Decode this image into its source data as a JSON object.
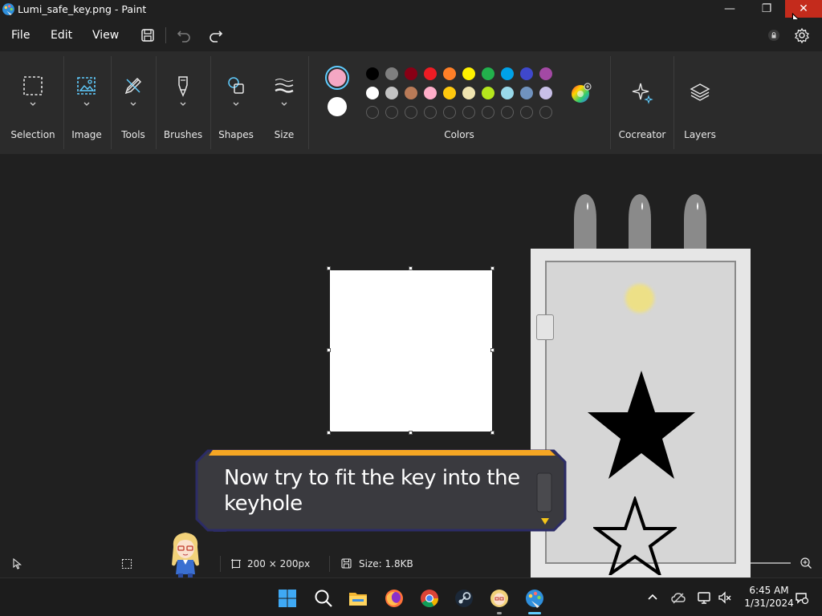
{
  "window": {
    "title": "Lumi_safe_key.png - Paint",
    "minimize_glyph": "—",
    "maximize_glyph": "❐",
    "close_glyph": "✕"
  },
  "menu": {
    "file": "File",
    "edit": "Edit",
    "view": "View"
  },
  "ribbon": {
    "groups": {
      "selection": "Selection",
      "image": "Image",
      "tools": "Tools",
      "brushes": "Brushes",
      "shapes": "Shapes",
      "size": "Size",
      "colors": "Colors",
      "cocreator": "Cocreator",
      "layers": "Layers"
    },
    "primary_color": "#F4A7C3",
    "secondary_color": "#FFFFFF",
    "palette_row1": [
      "#000000",
      "#7f7f7f",
      "#880015",
      "#ed1c24",
      "#ff7f27",
      "#fff200",
      "#22b14c",
      "#00a2e8",
      "#3f48cc",
      "#a349a4"
    ],
    "palette_row2": [
      "#ffffff",
      "#c3c3c3",
      "#b97a57",
      "#ffaec9",
      "#ffc90e",
      "#efe4b0",
      "#b5e61d",
      "#99d9ea",
      "#7092be",
      "#c8bfe7"
    ],
    "palette_row3_count": 10
  },
  "dialog": {
    "text": "Now try to fit the key into the keyhole"
  },
  "status": {
    "canvas_size": "200 × 200px",
    "file_size": "Size: 1.8KB"
  },
  "taskbar": {
    "time": "6:45 AM",
    "date": "1/31/2024"
  },
  "colors": {
    "accent": "#60cdff",
    "close_red": "#c42b1c",
    "dialog_border": "#f5a623"
  }
}
